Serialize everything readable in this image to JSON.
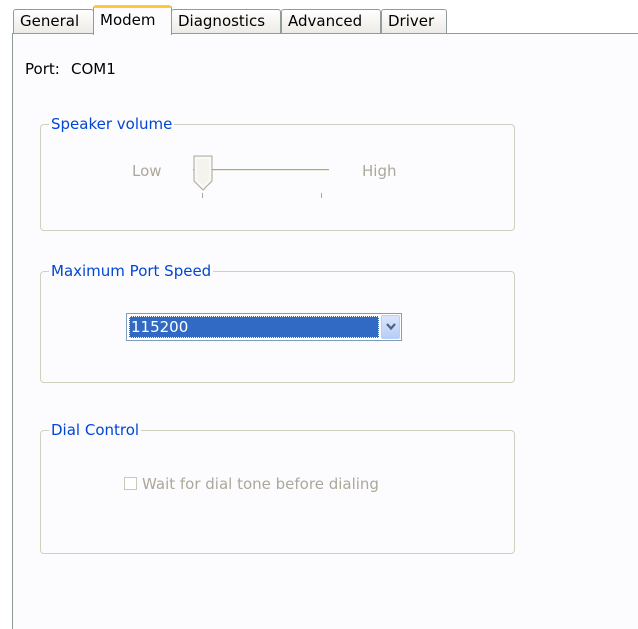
{
  "tabs": {
    "general": "General",
    "modem": "Modem",
    "diagnostics": "Diagnostics",
    "advanced": "Advanced",
    "driver": "Driver",
    "active": "Modem"
  },
  "port": {
    "label": "Port:",
    "value": "COM1"
  },
  "speaker_volume": {
    "title": "Speaker volume",
    "low_label": "Low",
    "high_label": "High",
    "level": 0,
    "enabled": false
  },
  "max_port_speed": {
    "title": "Maximum Port Speed",
    "selected": "115200"
  },
  "dial_control": {
    "title": "Dial Control",
    "checkbox_label": "Wait for dial tone before dialing",
    "checked": false,
    "enabled": false
  },
  "colors": {
    "group_title": "#0046d5",
    "disabled_text": "#aca899",
    "selection": "#316ac5",
    "active_tab_accent": "#ffc83c"
  }
}
